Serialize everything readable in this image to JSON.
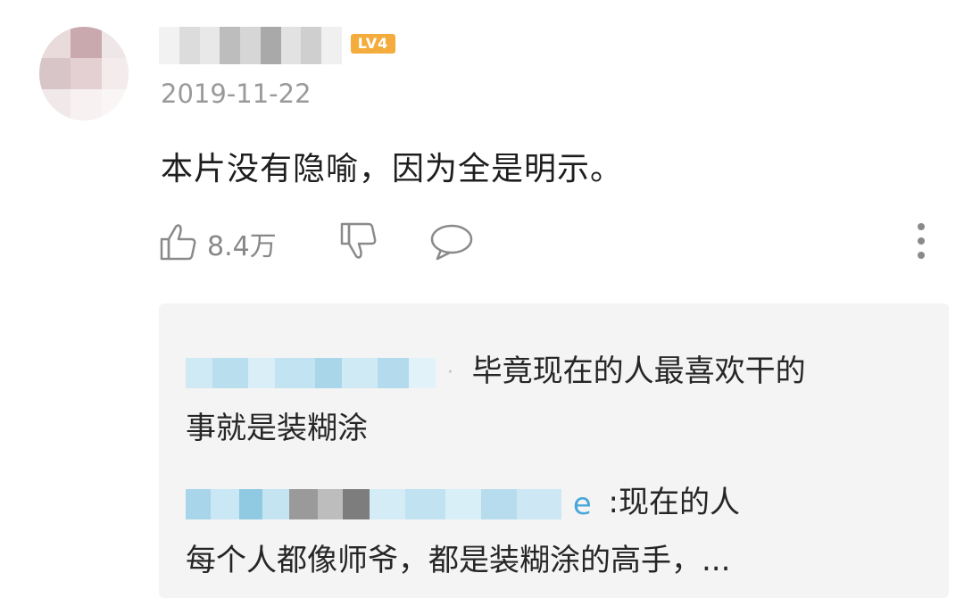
{
  "comment": {
    "level_badge": "LV4",
    "date": "2019-11-22",
    "text": "本片没有隐喻，因为全是明示。",
    "like_count": "8.4万"
  },
  "replies": [
    {
      "text_line1": "毕竟现在的人最喜欢干的",
      "text_line2": "事就是装糊涂"
    },
    {
      "name_tail": "e",
      "text_line1": ":现在的人",
      "text_line2": "每个人都像师爷，都是装糊涂的高手，..."
    }
  ],
  "colors": {
    "badge": "#f4ad3c",
    "date": "#9a9a9a",
    "icon": "#8a8a8a",
    "reply_bg": "#f4f4f4",
    "blur_blue": "#bfe3f2"
  },
  "icons": [
    "thumbs-up-icon",
    "thumbs-down-icon",
    "comment-bubble-icon",
    "more-vertical-icon"
  ]
}
